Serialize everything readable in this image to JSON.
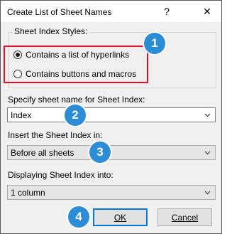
{
  "dialog": {
    "title": "Create List of Sheet Names",
    "help_symbol": "?",
    "close_symbol": "✕"
  },
  "index_styles": {
    "legend": "Sheet Index Styles:",
    "options": [
      {
        "label": "Contains a list of hyperlinks",
        "checked": true
      },
      {
        "label": "Contains buttons and macros",
        "checked": false
      }
    ]
  },
  "sheet_name": {
    "label": "Specify sheet name for Sheet Index:",
    "value": "Index"
  },
  "insert_in": {
    "label": "Insert the Sheet Index in:",
    "value": "Before all sheets"
  },
  "display_into": {
    "label": "Displaying Sheet Index into:",
    "value": "1 column"
  },
  "buttons": {
    "ok": "OK",
    "cancel": "Cancel"
  },
  "badges": [
    "1",
    "2",
    "3",
    "4"
  ],
  "colors": {
    "badge": "#2d8cd6",
    "highlight": "#e0102b",
    "default_button_border": "#0078d7"
  }
}
